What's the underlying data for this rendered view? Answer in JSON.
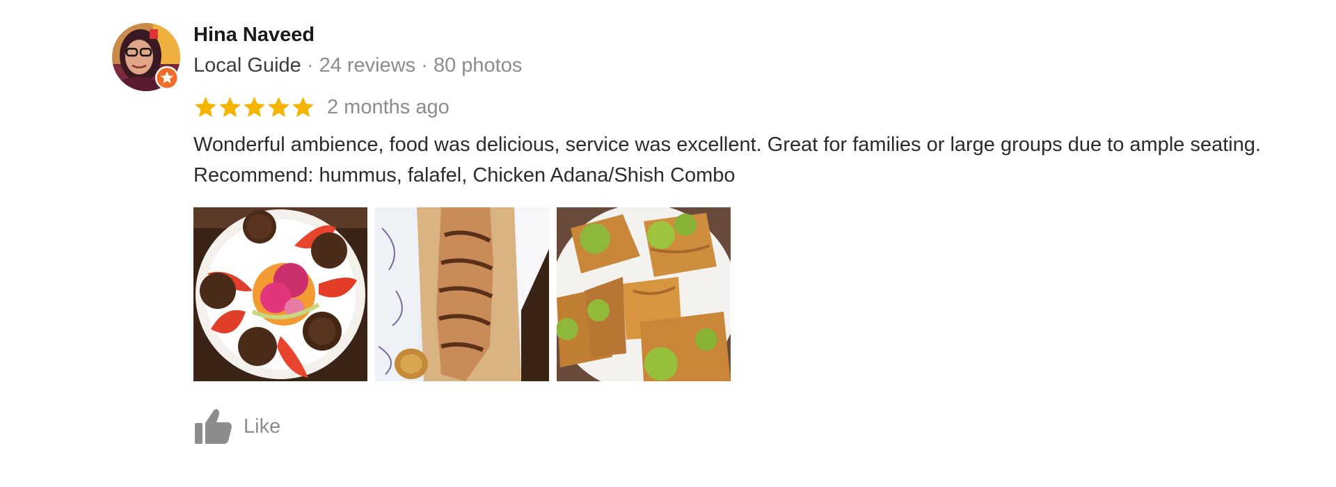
{
  "review": {
    "author_name": "Hina Naveed",
    "author_level": "Local Guide",
    "separator": " · ",
    "reviews_count": "24 reviews",
    "photos_count": "80 photos",
    "rating": 5,
    "rating_max": 5,
    "time_ago": "2 months ago",
    "text_line1": "Wonderful ambience, food was delicious, service was excellent. Great for families or large groups due to ample seating.",
    "text_line2": "Recommend: hummus, falafel, Chicken Adana/Shish Combo",
    "photos": [
      {
        "icon": "falafel-plate-photo"
      },
      {
        "icon": "flatbread-photo"
      },
      {
        "icon": "baklava-photo"
      }
    ],
    "like_label": "Like"
  },
  "colors": {
    "star": "#f5b400",
    "guide_badge": "#ef6c2a",
    "secondary_text": "#8c8c8c",
    "primary_text": "#1a1a1a"
  }
}
